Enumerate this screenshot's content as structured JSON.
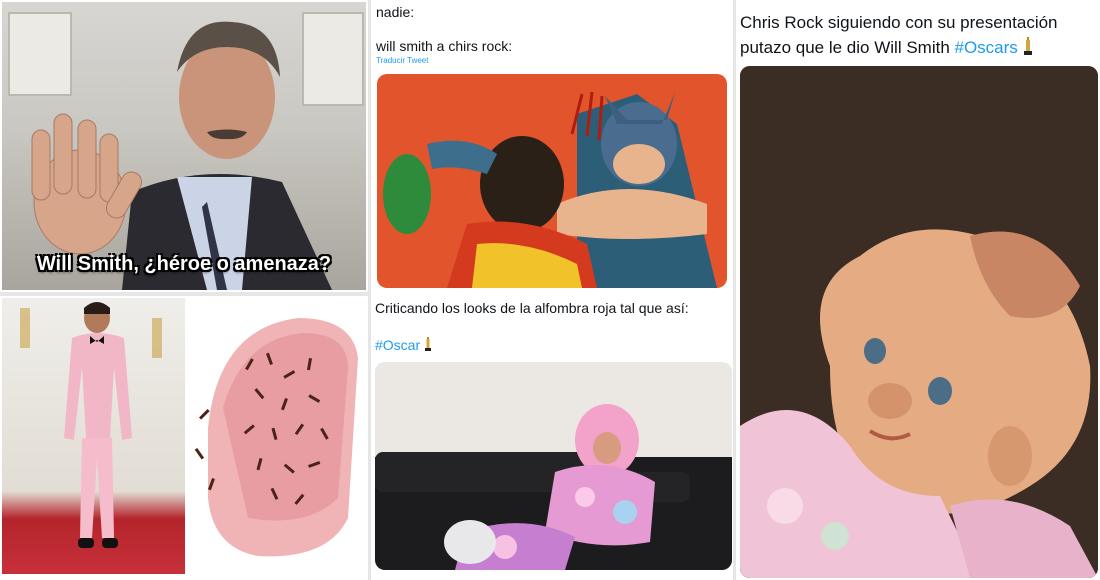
{
  "meme_jj": {
    "caption": "Will Smith, ¿héroe o amenaza?"
  },
  "meme_suit": {},
  "tweet_batman": {
    "line1": "nadie:",
    "line2": "will smith a chirs rock:",
    "translate": "Traducir Tweet"
  },
  "tweet_redcarpet": {
    "line1": "Criticando los looks de la alfombra roja tal que así:",
    "hashtag": "#Oscar"
  },
  "tweet_doll": {
    "line1": "Chris Rock siguiendo con su presentación",
    "line2_text": "putazo que le dio Will Smith ",
    "hashtag": "#Oscars"
  },
  "colors": {
    "twitter_blue": "#1d9bf0",
    "batman_bg": "#e2542b",
    "red_carpet": "#c7303a"
  },
  "icons": [
    "oscar-statuette-icon"
  ]
}
